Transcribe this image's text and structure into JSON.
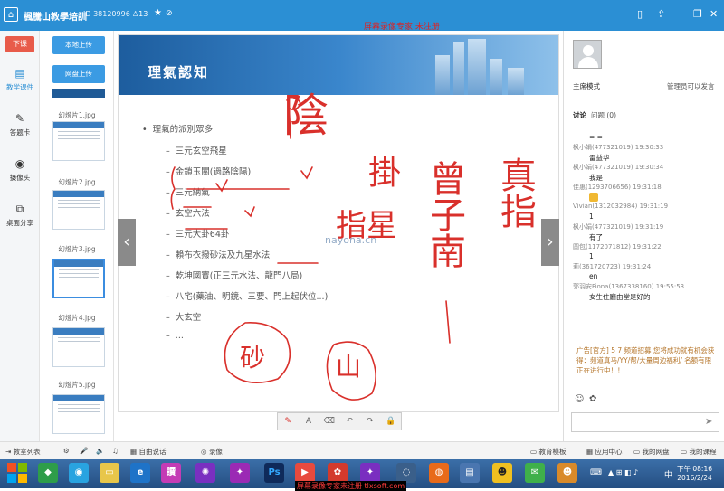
{
  "titlebar": {
    "title": "楓騰山教學培訓",
    "room_id": "ID 38120996",
    "users": "13",
    "watermark": "屏幕录像专家 未注册"
  },
  "leftnav": {
    "end_button": "下课",
    "items": [
      {
        "label": "教学课件",
        "icon": "courseware-icon"
      },
      {
        "label": "答题卡",
        "icon": "answer-card-icon"
      },
      {
        "label": "摄像头",
        "icon": "camera-icon"
      },
      {
        "label": "桌面分享",
        "icon": "desktop-share-icon"
      }
    ]
  },
  "slides": {
    "upload_local": "本地上传",
    "upload_cloud": "网盘上传",
    "items": [
      {
        "label": "幻燈片1.jpg"
      },
      {
        "label": "幻燈片2.jpg"
      },
      {
        "label": "幻燈片3.jpg"
      },
      {
        "label": "幻燈片4.jpg"
      },
      {
        "label": "幻燈片5.jpg"
      }
    ],
    "selected_index": 3
  },
  "slide": {
    "title": "理氣認知",
    "bullets": [
      "理氣的派別眾多",
      "三元玄空飛星",
      "金鎖玉關(過路陰陽)",
      "三元納氣",
      "玄空六法",
      "三元大卦64卦",
      "賴布衣撥砂法及九星水法",
      "乾坤國寶(正三元水法、龍門八局)",
      "八宅(藥油、明鏡、三要、門上起伏位...)",
      "大玄空",
      "..."
    ],
    "handwriting": [
      "陰",
      "掛",
      "指星",
      "砂",
      "山",
      "曾子南",
      "真指"
    ],
    "watermark": "nayona.cn"
  },
  "toolbar": {
    "tools": [
      "pen",
      "text",
      "eraser",
      "undo",
      "redo",
      "lock"
    ]
  },
  "right": {
    "mode": "主席模式",
    "note": "管理员可以发言",
    "tabs": [
      "讨论",
      "问题 (0)"
    ],
    "messages": [
      {
        "name": "",
        "text": "= ="
      },
      {
        "name": "枫小娟(477321019) 19:30:33",
        "text": "雷益华"
      },
      {
        "name": "枫小娟(477321019) 19:30:34",
        "text": "我是"
      },
      {
        "name": "佳惠(1293706656) 19:31:18",
        "text": ""
      },
      {
        "name": "Vivian(1312032984) 19:31:19",
        "text": "1"
      },
      {
        "name": "枫小娟(477321019) 19:31:19",
        "text": "有了"
      },
      {
        "name": "圆包(1172071812) 19:31:22",
        "text": "1"
      },
      {
        "name": "莉(361720723) 19:31:24",
        "text": "en"
      },
      {
        "name": "郭羽安Fiona(1367338160) 19:55:53",
        "text": "女生住廳由堂是好的"
      }
    ],
    "ad": "广告[官方] 5 7 频道招募 您将成功就有机会获得：频道真马/YY/帮/大量周边福利/ 名额有限 正在进行中！！"
  },
  "bottombar": {
    "left": [
      "教室列表",
      "自由说话",
      "录像"
    ],
    "right": [
      "教育模板",
      "应用中心",
      "我的网盘",
      "我的课程"
    ]
  },
  "taskbar": {
    "time": "下午 08:16",
    "date": "2016/2/24",
    "watermark": "屏幕录像专家未注册 tlxsoft.com"
  }
}
